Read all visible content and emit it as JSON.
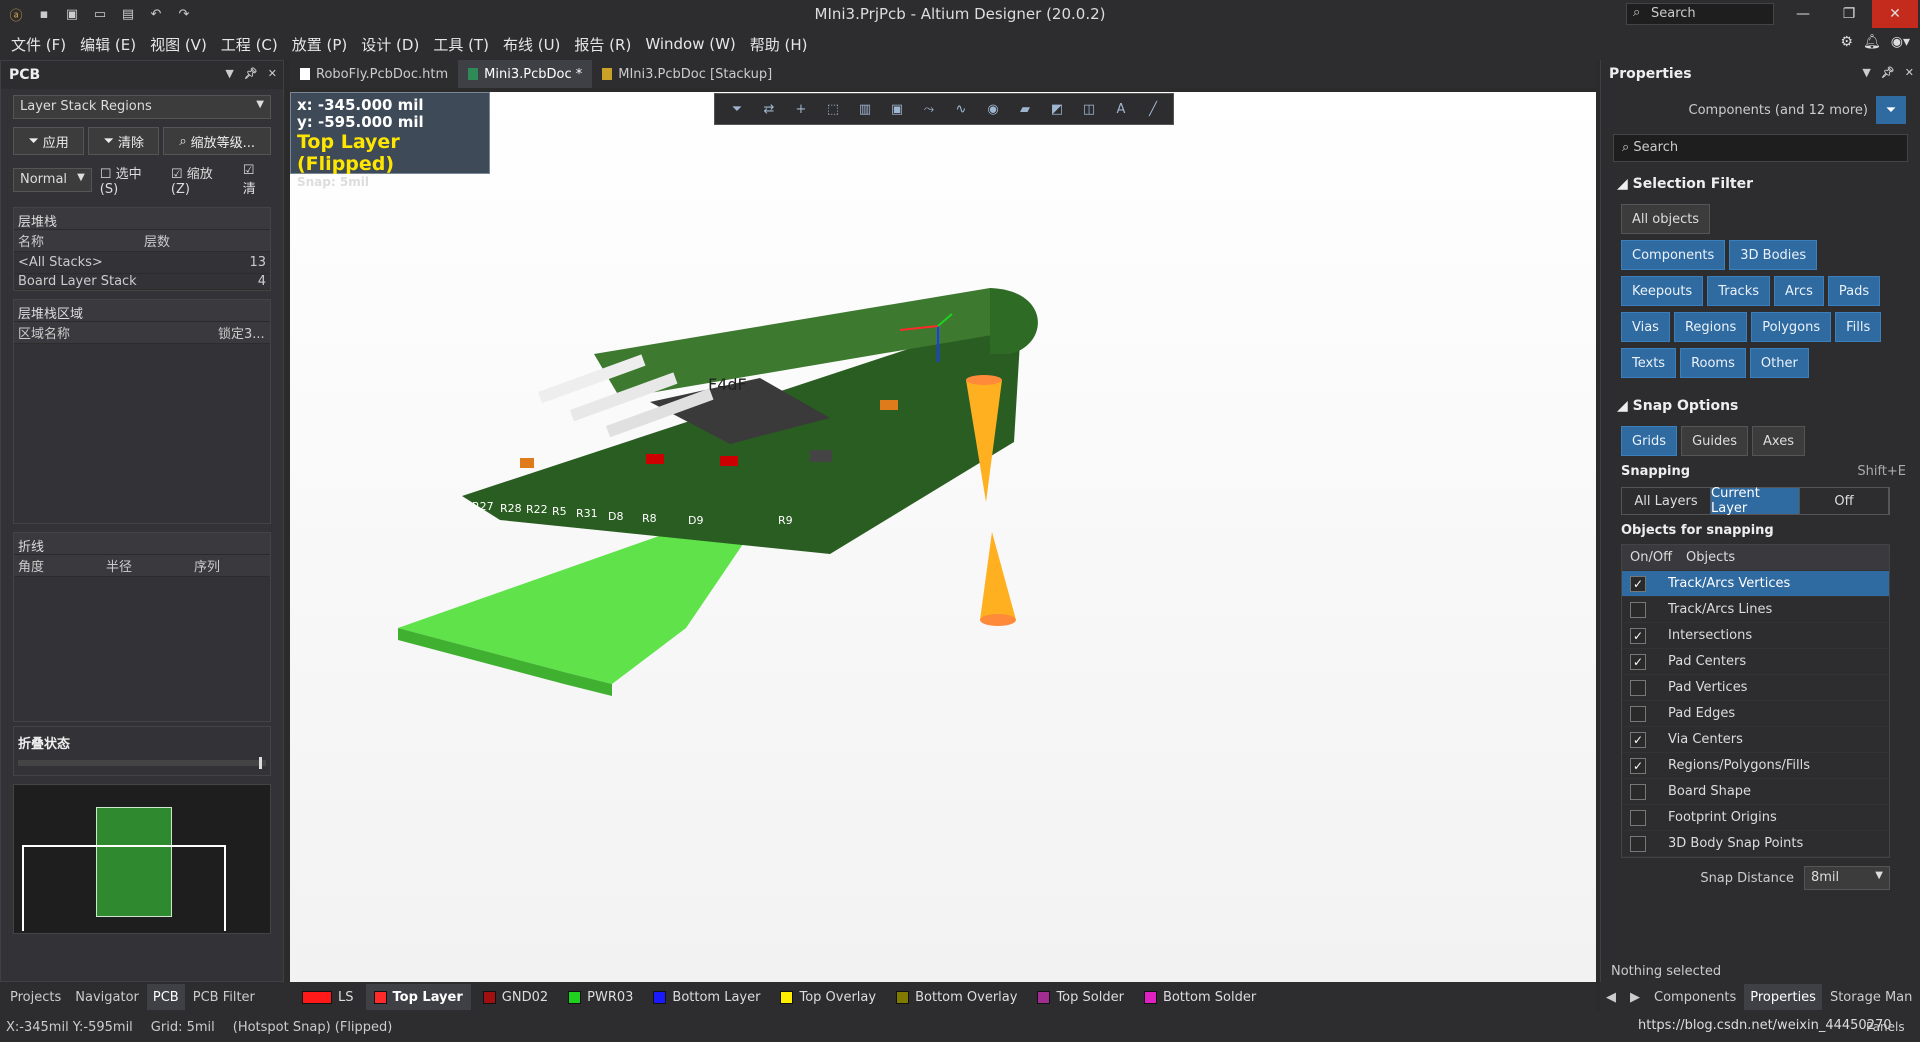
{
  "app": {
    "title": "MIni3.PrjPcb - Altium Designer (20.0.2)",
    "search_placeholder": "Search"
  },
  "menu": [
    "文件 (F)",
    "编辑 (E)",
    "视图 (V)",
    "工程 (C)",
    "放置 (P)",
    "设计 (D)",
    "工具 (T)",
    "布线 (U)",
    "报告 (R)",
    "Window (W)",
    "帮助 (H)"
  ],
  "left_panel": {
    "title": "PCB",
    "mode_select": "Layer Stack Regions",
    "btn_apply": "应用",
    "btn_clear": "清除",
    "btn_zoom": "缩放等级...",
    "mask_select": "Normal",
    "chk_select": "选中 (S)",
    "chk_zoom": "缩放 (Z)",
    "chk_clear": "清",
    "stack_title": "层堆栈",
    "stack_cols": [
      "名称",
      "层数"
    ],
    "stack_rows": [
      [
        "<All Stacks>",
        "13"
      ],
      [
        "Board Layer Stack",
        "4"
      ]
    ],
    "region_title": "层堆栈区域",
    "region_cols": [
      "区域名称",
      "锁定3..."
    ],
    "bend_title": "折线",
    "bend_cols": [
      "角度",
      "半径",
      "序列"
    ],
    "fold_title": "折叠状态"
  },
  "tabs": [
    {
      "label": "RoboFly.PcbDoc.htm"
    },
    {
      "label": "Mini3.PcbDoc *"
    },
    {
      "label": "MIni3.PcbDoc [Stackup]"
    }
  ],
  "hud": {
    "x": "x:  -345.000 mil",
    "y": "y:  -595.000 mil",
    "layer": "Top Layer (Flipped)",
    "snap": "Snap: 5mil"
  },
  "board_labels": [
    "R27",
    "R28",
    "R22",
    "R5",
    "R31",
    "D8",
    "R8",
    "D9",
    "R9"
  ],
  "chip_text": "F4dF",
  "layers": [
    {
      "name": "LS",
      "color": "#ff1a1a"
    },
    {
      "name": "Top Layer",
      "color": "#ff2a2a"
    },
    {
      "name": "GND02",
      "color": "#a01010"
    },
    {
      "name": "PWR03",
      "color": "#1fd11f"
    },
    {
      "name": "Bottom Layer",
      "color": "#1a1aff"
    },
    {
      "name": "Top Overlay",
      "color": "#ffee00"
    },
    {
      "name": "Bottom Overlay",
      "color": "#807a00"
    },
    {
      "name": "Top Solder",
      "color": "#a02d8f"
    },
    {
      "name": "Bottom Solder",
      "color": "#e020c0"
    }
  ],
  "bottom_left_tabs": [
    "Projects",
    "Navigator",
    "PCB",
    "PCB Filter"
  ],
  "status": {
    "coords": "X:-345mil Y:-595mil",
    "grid": "Grid: 5mil",
    "snap": "(Hotspot Snap) (Flipped)",
    "url": "https://blog.csdn.net/weixin_44450270"
  },
  "properties": {
    "title": "Properties",
    "filter_summary": "Components (and 12 more)",
    "search_placeholder": "Search",
    "selection_filter_title": "Selection Filter",
    "filter_buttons": [
      "All objects",
      "Components",
      "3D Bodies",
      "Keepouts",
      "Tracks",
      "Arcs",
      "Pads",
      "Vias",
      "Regions",
      "Polygons",
      "Fills",
      "Texts",
      "Rooms",
      "Other"
    ],
    "snap_title": "Snap Options",
    "snap_buttons": [
      "Grids",
      "Guides",
      "Axes"
    ],
    "snapping_label": "Snapping",
    "snapping_shortcut": "Shift+E",
    "snapping_modes": [
      "All Layers",
      "Current Layer",
      "Off"
    ],
    "objects_title": "Objects for snapping",
    "objects_cols": [
      "On/Off",
      "Objects"
    ],
    "objects": [
      {
        "name": "Track/Arcs Vertices",
        "on": true
      },
      {
        "name": "Track/Arcs Lines",
        "on": false
      },
      {
        "name": "Intersections",
        "on": true
      },
      {
        "name": "Pad Centers",
        "on": true
      },
      {
        "name": "Pad Vertices",
        "on": false
      },
      {
        "name": "Pad Edges",
        "on": false
      },
      {
        "name": "Via Centers",
        "on": true
      },
      {
        "name": "Regions/Polygons/Fills",
        "on": true
      },
      {
        "name": "Board Shape",
        "on": false
      },
      {
        "name": "Footprint Origins",
        "on": false
      },
      {
        "name": "3D Body Snap Points",
        "on": false
      }
    ],
    "snap_distance_label": "Snap Distance",
    "snap_distance": "8mil",
    "nothing_selected": "Nothing selected",
    "bottom_tabs": [
      "Components",
      "Properties",
      "Storage Man"
    ],
    "panels_label": "Panels"
  }
}
